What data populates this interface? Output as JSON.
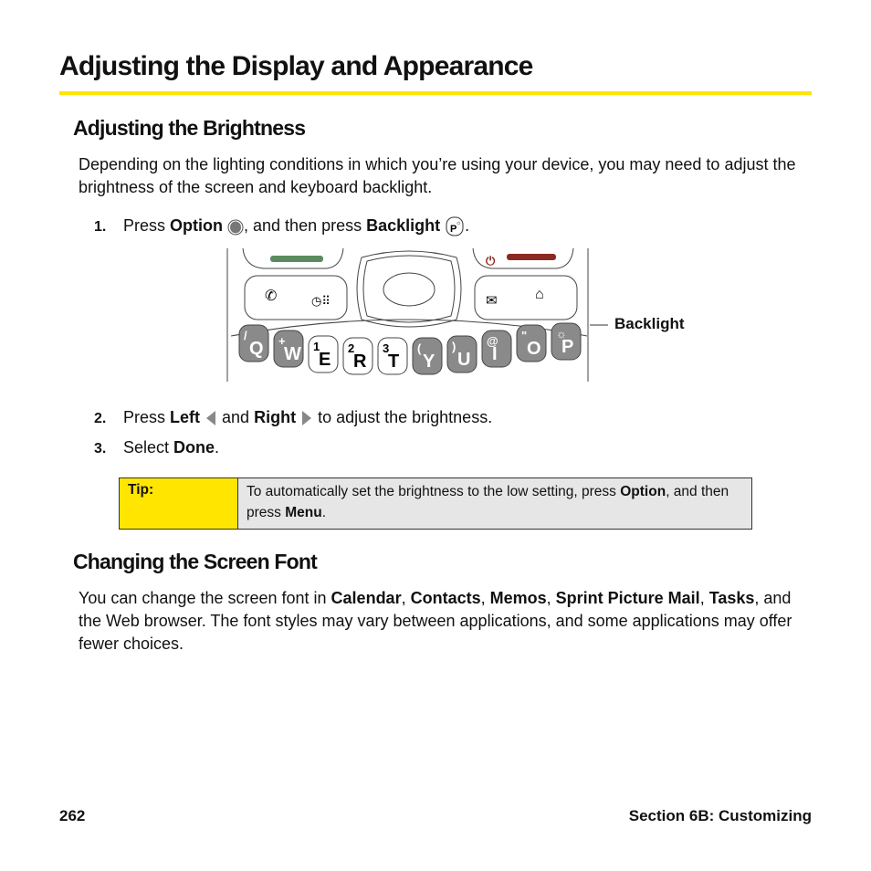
{
  "title": "Adjusting the Display and Appearance",
  "section1": {
    "heading": "Adjusting the Brightness",
    "intro": "Depending on the lighting conditions in which you’re using your device, you may need to adjust the brightness of the screen and keyboard backlight.",
    "steps": [
      {
        "num": "1.",
        "parts": [
          "Press ",
          "Option",
          ", and then press ",
          "Backlight",
          "."
        ]
      },
      {
        "num": "2.",
        "parts": [
          "Press ",
          "Left",
          " and ",
          "Right",
          " to adjust the brightness."
        ]
      },
      {
        "num": "3.",
        "parts": [
          "Select ",
          "Done",
          "."
        ]
      }
    ],
    "figure": {
      "callout": "Backlight",
      "keys": [
        {
          "main": "Q",
          "alt": "/"
        },
        {
          "main": "W",
          "alt": "+"
        },
        {
          "main": "E",
          "alt": "1"
        },
        {
          "main": "R",
          "alt": "2"
        },
        {
          "main": "T",
          "alt": "3"
        },
        {
          "main": "Y",
          "alt": "("
        },
        {
          "main": "U",
          "alt": ")"
        },
        {
          "main": "I",
          "alt": "@"
        },
        {
          "main": "O",
          "alt": "\""
        },
        {
          "main": "P",
          "alt": "☼"
        }
      ]
    },
    "tip": {
      "label": "Tip:",
      "parts": [
        "To automatically set the brightness to the low setting, press ",
        "Option",
        ", and then press ",
        "Menu",
        "."
      ]
    }
  },
  "section2": {
    "heading": "Changing the Screen Font",
    "parts": [
      "You can change the screen font in ",
      "Calendar",
      ", ",
      "Contacts",
      ", ",
      "Memos",
      ", ",
      "Sprint Picture Mail",
      ", ",
      "Tasks",
      ", and the Web browser. The font styles may vary between applications, and some applications may offer fewer choices."
    ]
  },
  "footer": {
    "page": "262",
    "section": "Section 6B: Customizing"
  },
  "colors": {
    "accent": "#ffe500",
    "tip_bg": "#e6e6e6",
    "green_key": "#5b8a5e",
    "red_key": "#8b2a22"
  }
}
